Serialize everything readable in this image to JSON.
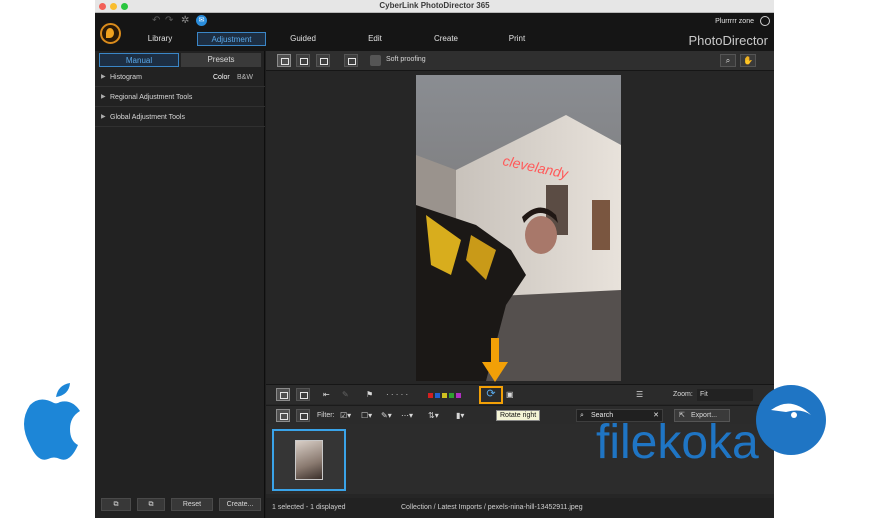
{
  "window": {
    "title": "CyberLink PhotoDirector 365"
  },
  "header": {
    "tabs": [
      {
        "label": "Library"
      },
      {
        "label": "Adjustment"
      },
      {
        "label": "Guided"
      },
      {
        "label": "Edit"
      },
      {
        "label": "Create"
      },
      {
        "label": "Print"
      }
    ],
    "active_tab": "Adjustment",
    "user_name": "Plurrrrr zone",
    "brand": "PhotoDirector"
  },
  "left_panel": {
    "tabs": {
      "manual": "Manual",
      "presets": "Presets"
    },
    "sections": [
      {
        "label": "Histogram",
        "options": [
          "Color",
          "B&W"
        ]
      },
      {
        "label": "Regional Adjustment Tools"
      },
      {
        "label": "Global Adjustment Tools"
      }
    ],
    "bottom_buttons": {
      "reset": "Reset",
      "create": "Create..."
    }
  },
  "viewer_toolbar": {
    "soft_proofing_label": "Soft proofing"
  },
  "strip": {
    "zoom_label": "Zoom:",
    "zoom_value": "Fit",
    "filter_label": "Filter:",
    "search_placeholder": "Search",
    "export_label": "Export...",
    "tooltip": "Rotate right",
    "dots": "· · · · ·",
    "color_labels": [
      "#d32020",
      "#2060d0",
      "#d0c020",
      "#30a030",
      "#b030c0"
    ]
  },
  "status": {
    "selection": "1 selected - 1 displayed",
    "path": "Collection / Latest Imports / pexels-nina-hill-13452911.jpeg"
  },
  "photo": {
    "neon_text": "clevelandy"
  },
  "watermark": {
    "text": "filekoka"
  },
  "colors": {
    "accent_blue": "#3a86c7",
    "highlight_orange": "#f2a007",
    "apple_blue": "#1d86d7",
    "filekoka_blue": "#1f75c4"
  }
}
